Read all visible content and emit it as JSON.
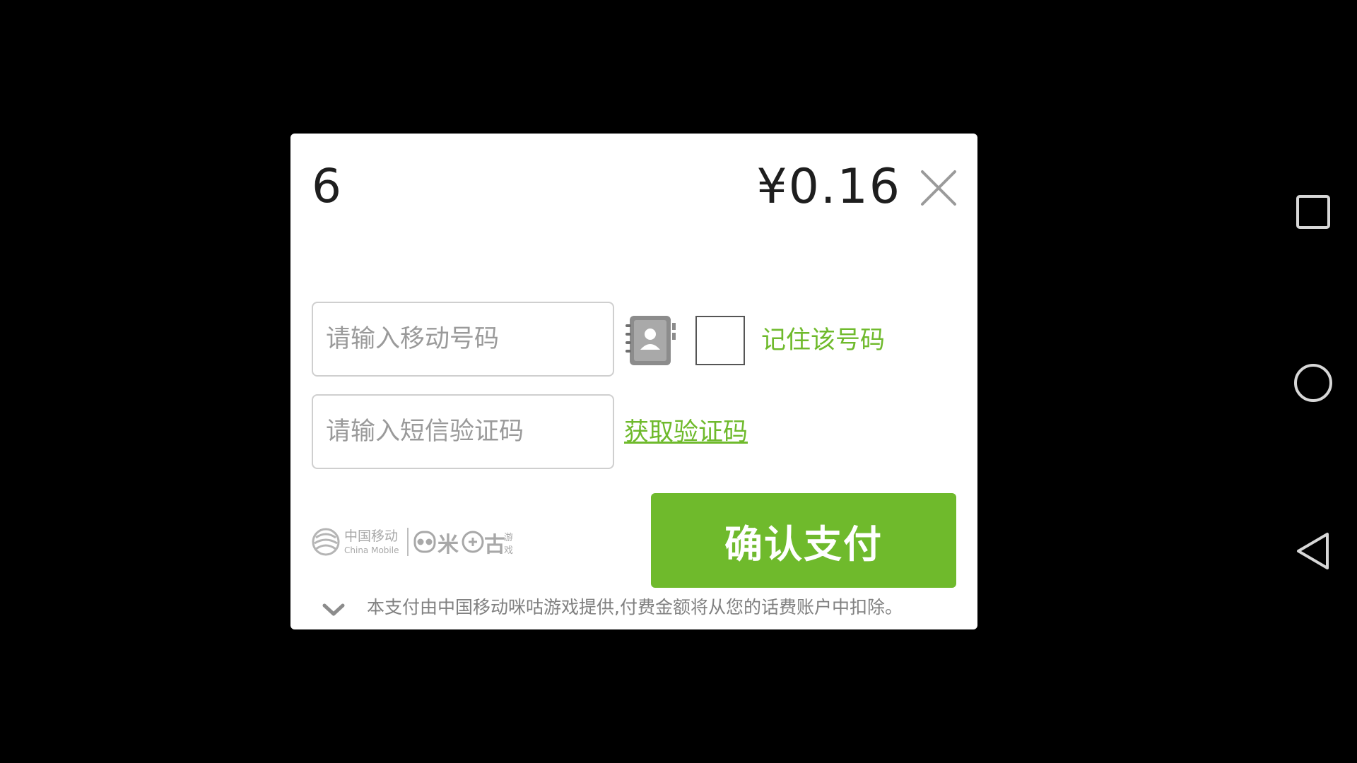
{
  "dialog": {
    "product_name": "6",
    "price": "¥0.16",
    "phone_input": {
      "value": "",
      "placeholder": "请输入移动号码"
    },
    "code_input": {
      "value": "",
      "placeholder": "请输入短信验证码"
    },
    "remember_label": "记住该号码",
    "remember_checked": false,
    "get_code_label": "获取验证码",
    "confirm_label": "确认支付",
    "disclaimer": "本支付由中国移动咪咕游戏提供,付费金额将从您的话费账户中扣除。",
    "brand": {
      "cn_name": "中国移动",
      "en_name": "China Mobile",
      "game_brand": "咪咕游戏"
    }
  },
  "colors": {
    "accent": "#6fba2c",
    "background": "#000000",
    "dialog": "#ffffff"
  },
  "icons": {
    "close": "close-icon",
    "contacts": "contacts-book-icon",
    "expand": "chevron-down-icon",
    "nav_recents": "square-icon",
    "nav_home": "circle-icon",
    "nav_back": "triangle-back-icon"
  }
}
